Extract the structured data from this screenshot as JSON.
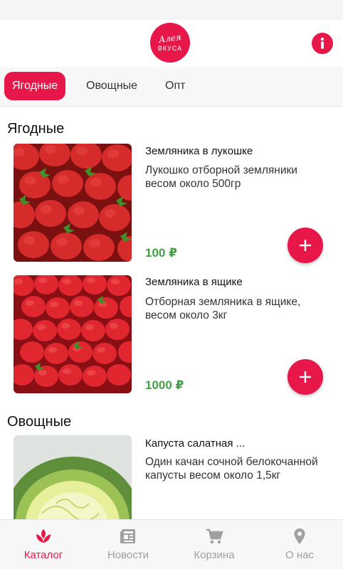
{
  "header": {
    "logo_line1": "Алея",
    "logo_line2": "ВКУСА",
    "info_icon": "info-icon"
  },
  "tabs": [
    {
      "label": "Ягодные",
      "active": true
    },
    {
      "label": "Овощные",
      "active": false
    },
    {
      "label": "Опт",
      "active": false
    }
  ],
  "sections": [
    {
      "title": "Ягодные",
      "products": [
        {
          "name": "Земляника в лукошке",
          "description": "Лукошко отборной земляники весом около 500гр",
          "price": "100 ₽",
          "image": "strawberries-basket"
        },
        {
          "name": "Земляника в ящике",
          "description": "Отборная земляника в ящике, весом около 3кг",
          "price": "1000 ₽",
          "image": "strawberries-box"
        }
      ]
    },
    {
      "title": "Овощные",
      "products": [
        {
          "name": "Капуста салатная ...",
          "description": "Один качан сочной белокочанной капусты весом около 1,5кг",
          "image": "cabbage"
        }
      ]
    }
  ],
  "add_icon": "plus-icon",
  "bottom_nav": [
    {
      "label": "Каталог",
      "icon": "catalog-icon",
      "active": true
    },
    {
      "label": "Новости",
      "icon": "news-icon",
      "active": false
    },
    {
      "label": "Корзина",
      "icon": "cart-icon",
      "active": false
    },
    {
      "label": "О нас",
      "icon": "location-pin-icon",
      "active": false
    }
  ],
  "colors": {
    "accent": "#e8174a",
    "price": "#43a047",
    "nav_inactive": "#9e9e9e"
  }
}
